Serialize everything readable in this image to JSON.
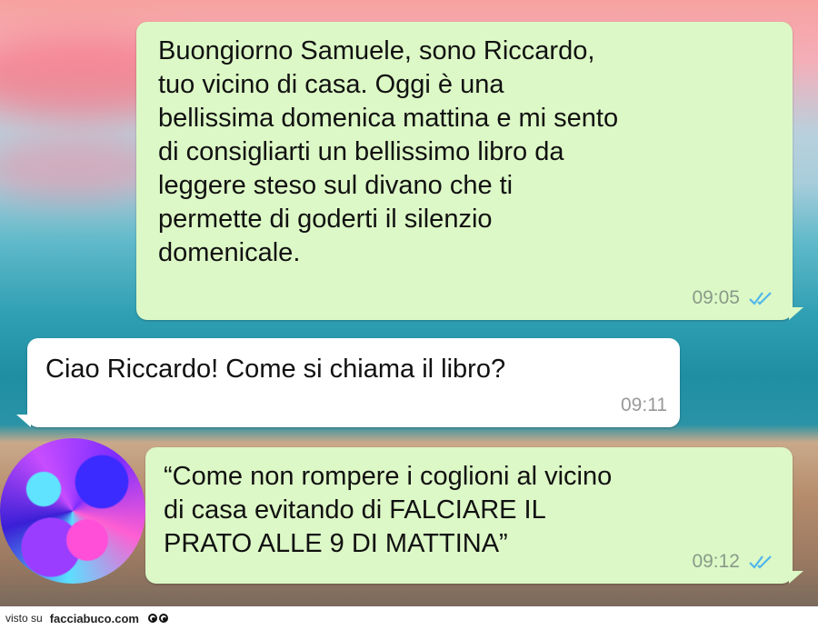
{
  "messages": [
    {
      "text": "Buongiorno Samuele, sono Riccardo,\ntuo vicino di casa. Oggi è una\nbellissima domenica mattina e mi sento\ndi consigliarti un bellissimo libro da\nleggere steso sul divano che ti\npermette di goderti il silenzio\ndomenicale.",
      "time": "09:05",
      "direction": "outgoing",
      "status": "read"
    },
    {
      "text": "Ciao Riccardo! Come si chiama il libro?",
      "time": "09:11",
      "direction": "incoming"
    },
    {
      "text": "“Come non rompere i coglioni al vicino\ndi casa evitando di FALCIARE IL\nPRATO ALLE 9 DI MATTINA”",
      "time": "09:12",
      "direction": "outgoing",
      "status": "read"
    }
  ],
  "footer": {
    "prefix": "visto su",
    "site": "facciabuco.com"
  },
  "colors": {
    "outgoing_bubble": "#dcf8c6",
    "incoming_bubble": "#ffffff",
    "read_tick": "#4fb6ec"
  }
}
